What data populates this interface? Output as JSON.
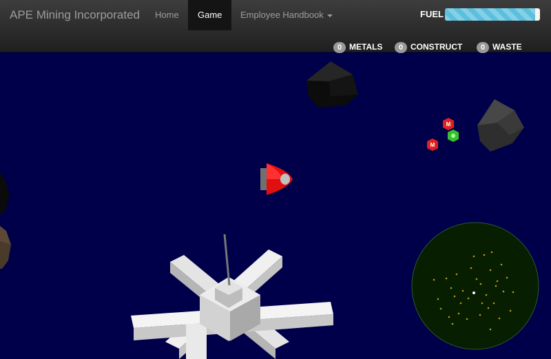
{
  "navbar": {
    "brand": "APE Mining Incorporated",
    "items": [
      {
        "label": "Home"
      },
      {
        "label": "Game"
      },
      {
        "label": "Employee Handbook"
      }
    ]
  },
  "hud": {
    "fuel_label": "FUEL",
    "fuel_level": 0.95,
    "fuel_color": "#5bc0de",
    "resources": [
      {
        "count": "0",
        "label": "METALS"
      },
      {
        "count": "0",
        "label": "CONSTRUCT"
      },
      {
        "count": "0",
        "label": "WASTE"
      }
    ]
  },
  "game": {
    "background_color": "#00004a",
    "pickups": [
      {
        "kind": "metal",
        "color": "#e02020",
        "icon": "hexagon-icon"
      },
      {
        "kind": "metal",
        "color": "#e02020",
        "icon": "hexagon-icon"
      },
      {
        "kind": "construct",
        "color": "#38c030",
        "icon": "hexagon-icon"
      }
    ],
    "minimap_color": "#081e00"
  }
}
